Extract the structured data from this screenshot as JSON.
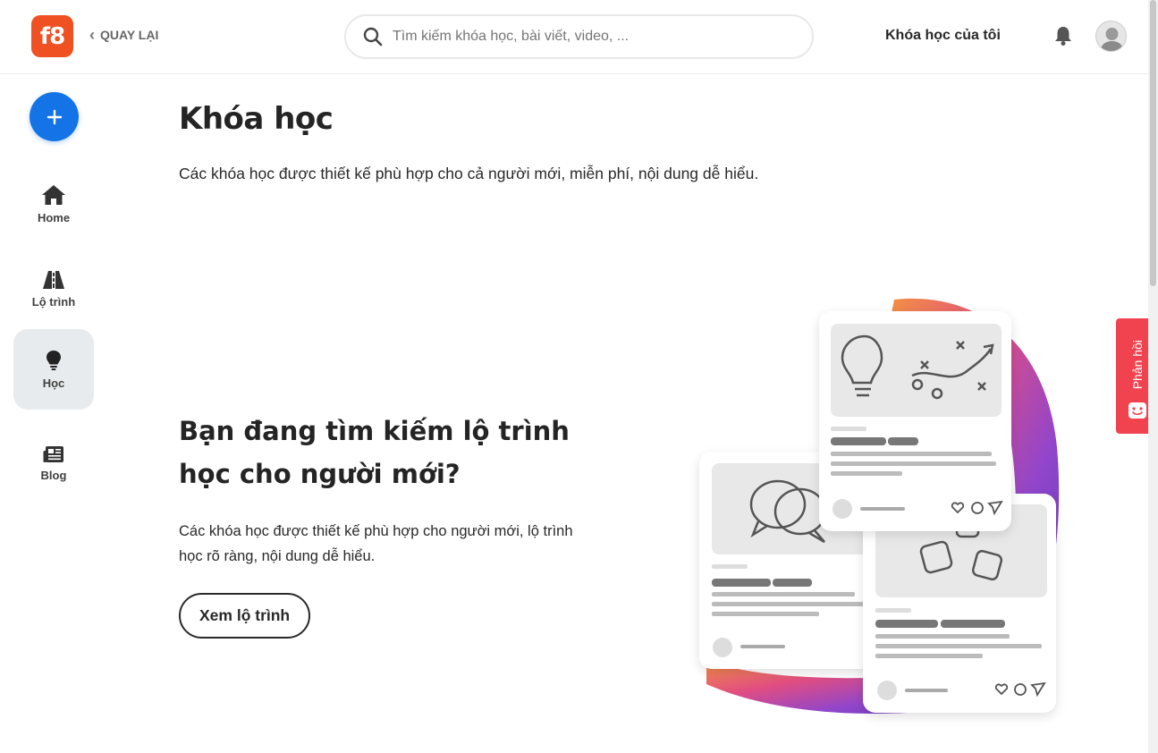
{
  "header": {
    "logo_text": "f8",
    "back_label": "QUAY LẠI",
    "search_placeholder": "Tìm kiếm khóa học, bài viết, video, ...",
    "my_courses_label": "Khóa học của tôi",
    "icons": [
      "chevron-left-icon",
      "search-icon",
      "bell-icon",
      "avatar"
    ],
    "brand_color": "#f05123"
  },
  "sidebar": {
    "create_button_icon": "plus-icon",
    "items": [
      {
        "label": "Home",
        "icon": "home-icon",
        "active": false
      },
      {
        "label": "Lộ trình",
        "icon": "road-icon",
        "active": false
      },
      {
        "label": "Học",
        "icon": "lightbulb-icon",
        "active": true
      },
      {
        "label": "Blog",
        "icon": "newspaper-icon",
        "active": false
      }
    ],
    "accent_color": "#1473e6"
  },
  "main": {
    "title": "Khóa học",
    "description": "Các khóa học được thiết kế phù hợp cho cả người mới, miễn phí, nội dung dễ hiểu.",
    "promo": {
      "title": "Bạn đang tìm kiếm lộ trình học cho người mới?",
      "description": "Các khóa học được thiết kế phù hợp cho người mới, lộ trình học rõ ràng, nội dung dễ hiểu.",
      "cta_label": "Xem lộ trình"
    }
  },
  "feedback": {
    "label": "Phản hồi",
    "color": "#f0424f"
  }
}
